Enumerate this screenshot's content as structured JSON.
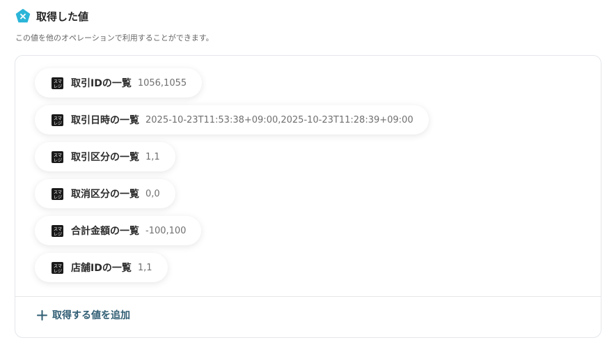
{
  "header": {
    "title": "取得した値",
    "icon": "yoom-pentagon-icon",
    "icon_color": "#2bb5d8"
  },
  "description": "この値を他のオペレーションで利用することができます。",
  "items": [
    {
      "label": "取引IDの一覧",
      "value": "1056,1055",
      "icon": "smaregi-app-icon"
    },
    {
      "label": "取引日時の一覧",
      "value": "2025-10-23T11:53:38+09:00,2025-10-23T11:28:39+09:00",
      "icon": "smaregi-app-icon"
    },
    {
      "label": "取引区分の一覧",
      "value": "1,1",
      "icon": "smaregi-app-icon"
    },
    {
      "label": "取消区分の一覧",
      "value": "0,0",
      "icon": "smaregi-app-icon"
    },
    {
      "label": "合計金額の一覧",
      "value": "-100,100",
      "icon": "smaregi-app-icon"
    },
    {
      "label": "店舗IDの一覧",
      "value": "1,1",
      "icon": "smaregi-app-icon"
    }
  ],
  "add_button": {
    "label": "取得する値を追加",
    "icon": "plus-icon",
    "color": "#2f5d73"
  }
}
